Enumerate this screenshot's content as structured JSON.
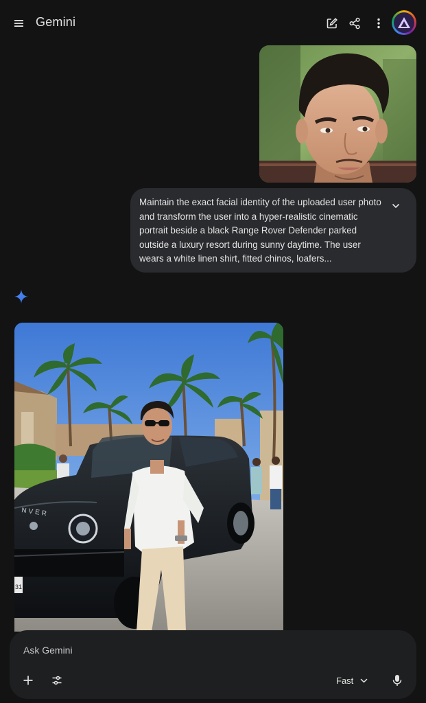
{
  "app": {
    "title": "Gemini"
  },
  "header": {
    "icons": [
      "menu-icon",
      "new-chat-icon",
      "share-icon",
      "more-vert-icon",
      "avatar"
    ]
  },
  "conversation": {
    "user_message": {
      "image": "uploaded user portrait photo",
      "text": "Maintain the exact facial identity of the uploaded user photo and transform the user into a hyper-realistic cinematic portrait beside a black Range Rover Defender parked outside a luxury resort during sunny daytime. The user wears a white linen shirt, fitted chinos, loafers..."
    },
    "assistant_message": {
      "image": "generated portrait beside black Range Rover Defender at resort",
      "vehicle_badge": "NVER",
      "plate": "31"
    }
  },
  "composer": {
    "placeholder": "Ask Gemini",
    "mode": "Fast"
  },
  "colors": {
    "background": "#131314",
    "bubble": "#2a2b2e",
    "composer": "#1e1f21",
    "accent_blue": "#4285f4"
  }
}
